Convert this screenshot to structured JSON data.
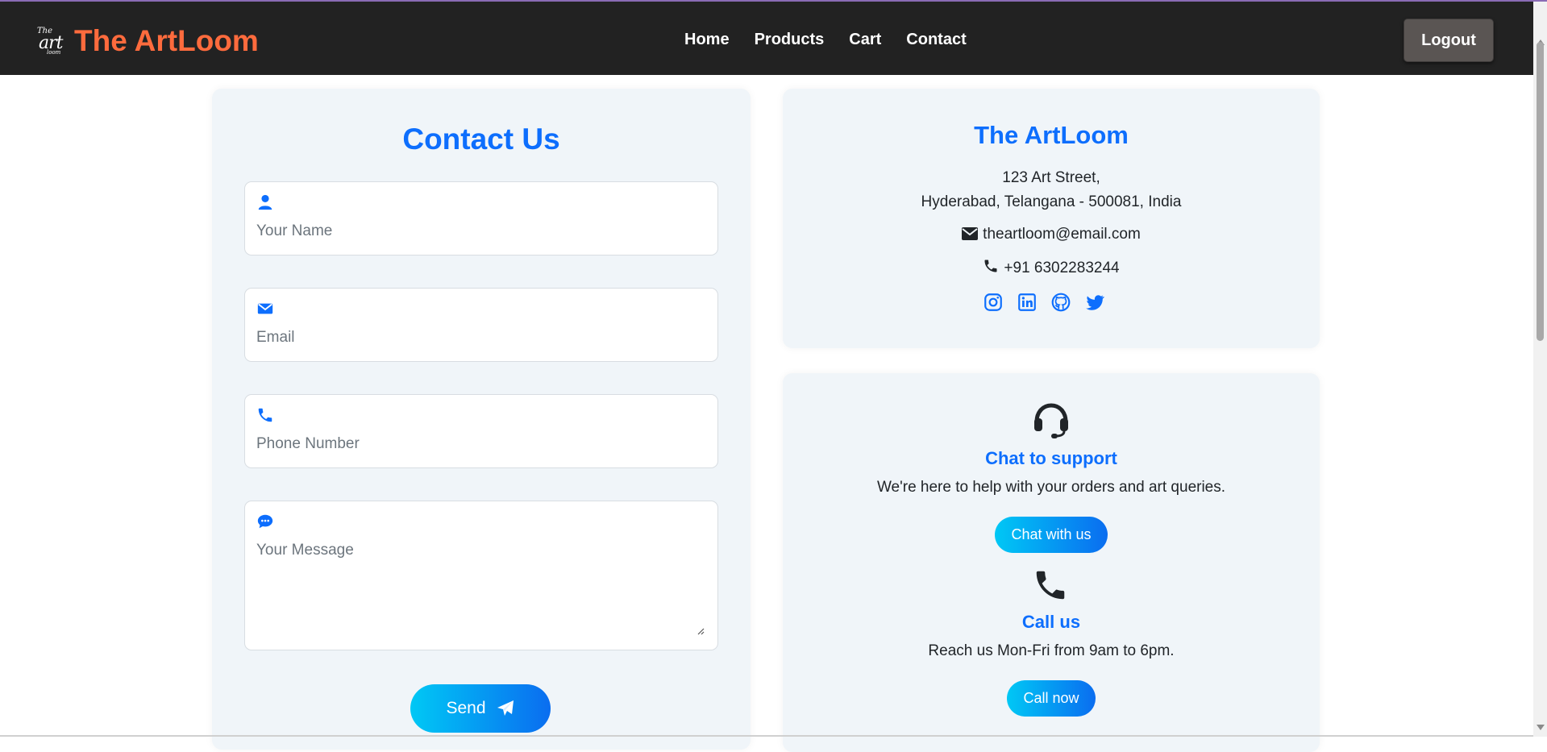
{
  "navbar": {
    "logo_text": [
      "The",
      "art",
      "loom"
    ],
    "brand": "The ArtLoom",
    "links": [
      "Home",
      "Products",
      "Cart",
      "Contact"
    ],
    "logout": "Logout"
  },
  "contact_form": {
    "title": "Contact Us",
    "name_placeholder": "Your Name",
    "email_placeholder": "Email",
    "phone_placeholder": "Phone Number",
    "message_placeholder": "Your Message",
    "send_label": "Send"
  },
  "info": {
    "title": "The ArtLoom",
    "address_line1": "123 Art Street,",
    "address_line2": "Hyderabad, Telangana - 500081, India",
    "email": "theartloom@email.com",
    "phone": "+91 6302283244",
    "socials": [
      "instagram-icon",
      "linkedin-icon",
      "github-icon",
      "twitter-icon"
    ]
  },
  "support": {
    "chat_title": "Chat to support",
    "chat_desc": "We're here to help with your orders and art queries.",
    "chat_button": "Chat with us",
    "call_title": "Call us",
    "call_desc": "Reach us Mon-Fri from 9am to 6pm.",
    "call_button": "Call now"
  },
  "colors": {
    "brand": "#ff6b3d",
    "accent": "#0d6efd",
    "navbar": "#222222",
    "card": "#f0f5f9"
  }
}
